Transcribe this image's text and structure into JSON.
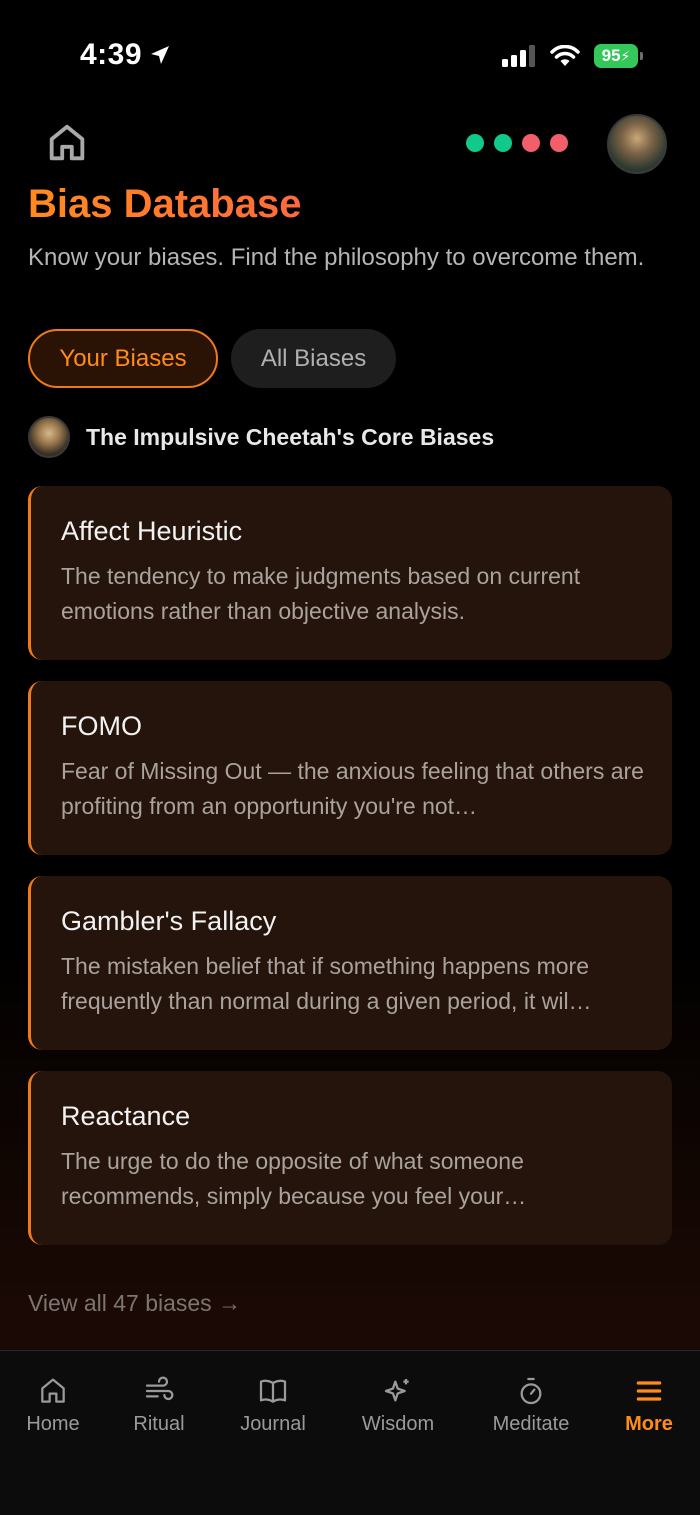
{
  "status_bar": {
    "time": "4:39",
    "battery": "95"
  },
  "header": {
    "indicator_dots": [
      "#10c98a",
      "#10c98a",
      "#f25e69",
      "#f25e69"
    ]
  },
  "page": {
    "title": "Bias Database",
    "subtitle": "Know your biases. Find the philosophy to overcome them."
  },
  "tabs": [
    {
      "label": "Your Biases",
      "active": true
    },
    {
      "label": "All Biases",
      "active": false
    }
  ],
  "section": {
    "title": "The Impulsive Cheetah's Core Biases"
  },
  "cards": [
    {
      "title": "Affect Heuristic",
      "description": "The tendency to make judgments based on current emotions rather than objective analysis."
    },
    {
      "title": "FOMO",
      "description": "Fear of Missing Out — the anxious feeling that others are profiting from an opportunity you're not…"
    },
    {
      "title": "Gambler's Fallacy",
      "description": "The mistaken belief that if something happens more frequently than normal during a given period, it wil…"
    },
    {
      "title": "Reactance",
      "description": "The urge to do the opposite of what someone recommends, simply because you feel your…"
    }
  ],
  "view_all": "View all 47 biases →",
  "nav": [
    {
      "label": "Home",
      "icon": "home-icon"
    },
    {
      "label": "Ritual",
      "icon": "wind-icon"
    },
    {
      "label": "Journal",
      "icon": "book-icon"
    },
    {
      "label": "Wisdom",
      "icon": "sparkles-icon"
    },
    {
      "label": "Meditate",
      "icon": "timer-icon"
    },
    {
      "label": "More",
      "icon": "menu-icon",
      "active": true
    }
  ],
  "colors": {
    "accent": "#ff8c1a",
    "card_bg": "#24140b"
  }
}
